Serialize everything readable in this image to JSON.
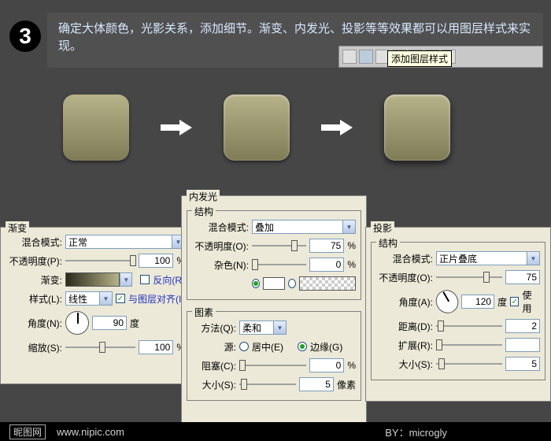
{
  "step": {
    "number": "3",
    "text": "确定大体颜色，光影关系，添加细节。渐变、内发光、投影等等效果都可以用图层样式来实现。",
    "tooltip": "添加图层样式"
  },
  "panels": {
    "gradient": {
      "title": "渐变",
      "blend_label": "混合模式:",
      "blend_value": "正常",
      "opacity_label": "不透明度(P):",
      "opacity_value": "100",
      "opacity_unit": "%",
      "grad_label": "渐变:",
      "reverse_label": "反向(R)",
      "style_label": "样式(L):",
      "style_value": "线性",
      "align_label": "与图层对齐(I)",
      "align_checked": "✓",
      "angle_label": "角度(N):",
      "angle_value": "90",
      "angle_unit": "度",
      "scale_label": "缩放(S):",
      "scale_value": "100",
      "scale_unit": "%"
    },
    "glow": {
      "title": "内发光",
      "g_struct": "结构",
      "blend_label": "混合模式:",
      "blend_value": "叠加",
      "opacity_label": "不透明度(O):",
      "opacity_value": "75",
      "opacity_unit": "%",
      "noise_label": "杂色(N):",
      "noise_value": "0",
      "noise_unit": "%",
      "g_elem": "图素",
      "method_label": "方法(Q):",
      "method_value": "柔和",
      "source_label": "源:",
      "source_center": "居中(E)",
      "source_edge": "边缘(G)",
      "choke_label": "阻塞(C):",
      "choke_value": "0",
      "choke_unit": "%",
      "size_label": "大小(S):",
      "size_value": "5",
      "size_unit": "像素"
    },
    "shadow": {
      "title": "投影",
      "g_struct": "结构",
      "blend_label": "混合模式:",
      "blend_value": "正片叠底",
      "opacity_label": "不透明度(O):",
      "opacity_value": "75",
      "angle_label": "角度(A):",
      "angle_value": "120",
      "angle_unit": "度",
      "use_global": "使用",
      "use_global_checked": "✓",
      "dist_label": "距离(D):",
      "dist_value": "2",
      "spread_label": "扩展(R):",
      "size_label": "大小(S):",
      "size_value": "5"
    }
  },
  "footer": {
    "brand": "昵图网",
    "url": "www.nipic.com",
    "by_label": "BY：",
    "by_value": "microgly"
  }
}
